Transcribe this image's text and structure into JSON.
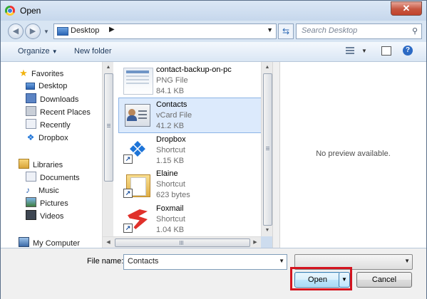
{
  "window": {
    "title": "Open"
  },
  "nav": {
    "address_path": "Desktop",
    "search_placeholder": "Search Desktop"
  },
  "toolbar": {
    "organize_label": "Organize",
    "new_folder_label": "New folder"
  },
  "sidebar": {
    "favorites": {
      "label": "Favorites",
      "items": [
        {
          "label": "Desktop",
          "icon": "desktop-icon"
        },
        {
          "label": "Downloads",
          "icon": "downloads-icon"
        },
        {
          "label": "Recent Places",
          "icon": "recent-places-icon"
        },
        {
          "label": "Recently",
          "icon": "document-icon"
        },
        {
          "label": "Dropbox",
          "icon": "dropbox-icon"
        }
      ]
    },
    "libraries": {
      "label": "Libraries",
      "items": [
        {
          "label": "Documents",
          "icon": "documents-icon"
        },
        {
          "label": "Music",
          "icon": "music-icon"
        },
        {
          "label": "Pictures",
          "icon": "pictures-icon"
        },
        {
          "label": "Videos",
          "icon": "videos-icon"
        }
      ]
    },
    "computer": {
      "label": "My Computer"
    }
  },
  "files": [
    {
      "name": "contact-backup-on-pc",
      "type": "PNG File",
      "size": "84.1 KB",
      "icon": "png-thumbnail"
    },
    {
      "name": "Contacts",
      "type": "vCard File",
      "size": "41.2 KB",
      "icon": "vcard-icon",
      "selected": true
    },
    {
      "name": "Dropbox",
      "type": "Shortcut",
      "size": "1.15 KB",
      "icon": "dropbox-icon"
    },
    {
      "name": "Elaine",
      "type": "Shortcut",
      "size": "623 bytes",
      "icon": "folder-icon"
    },
    {
      "name": "Foxmail",
      "type": "Shortcut",
      "size": "1.04 KB",
      "icon": "foxmail-icon"
    }
  ],
  "preview": {
    "text": "No preview available."
  },
  "bottom": {
    "file_name_label": "File name:",
    "file_name_value": "Contacts",
    "open_label": "Open",
    "cancel_label": "Cancel"
  },
  "colors": {
    "highlight": "#d4141f",
    "selection": "#dceafc",
    "accent": "#2c6ac4"
  }
}
